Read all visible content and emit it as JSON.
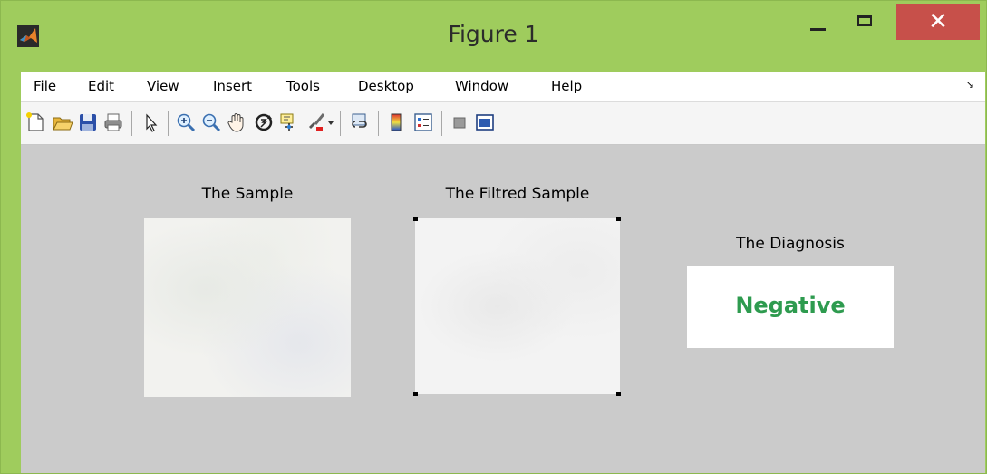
{
  "window": {
    "title": "Figure 1",
    "close_symbol": "✕"
  },
  "menu": {
    "items": [
      "File",
      "Edit",
      "View",
      "Insert",
      "Tools",
      "Desktop",
      "Window",
      "Help"
    ],
    "overflow_arrow": "↘"
  },
  "toolbar": {
    "icons": [
      "new-figure-icon",
      "open-file-icon",
      "save-icon",
      "print-icon",
      "edit-plot-pointer-icon",
      "zoom-in-icon",
      "zoom-out-icon",
      "pan-hand-icon",
      "rotate-3d-icon",
      "data-cursor-icon",
      "brush-icon",
      "link-plot-icon",
      "colorbar-icon",
      "legend-icon",
      "hide-plot-tools-icon",
      "show-plot-tools-icon"
    ]
  },
  "figure": {
    "sample_title": "The Sample",
    "filtered_title": "The Filtred Sample",
    "diagnosis_title": "The Diagnosis",
    "diagnosis_value": "Negative"
  },
  "colors": {
    "titlebar": "#9fcc5d",
    "close_button": "#c7504a",
    "figure_background": "#cbcbcb",
    "diagnosis_text": "#2e9b4f"
  }
}
